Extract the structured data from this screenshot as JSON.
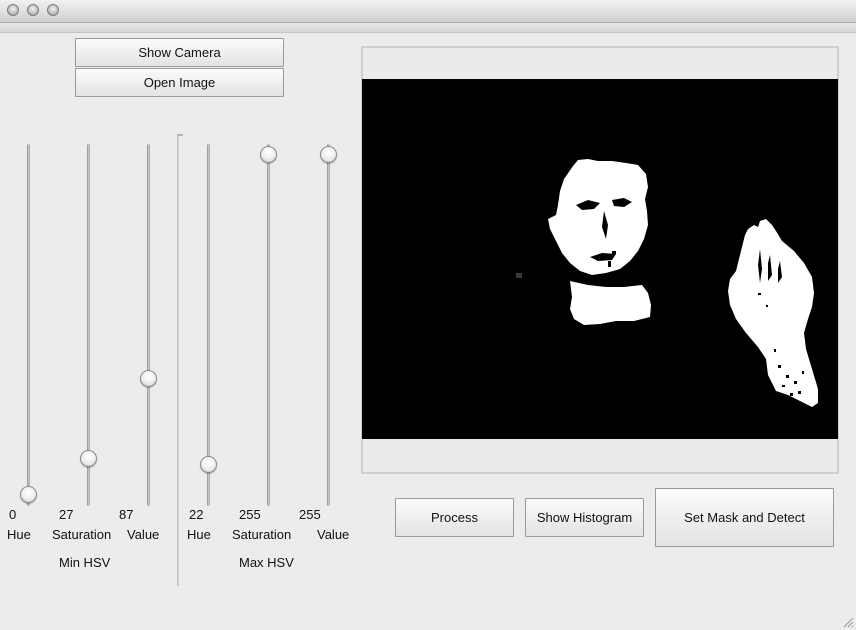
{
  "toolbar": {
    "show_camera_label": "Show Camera",
    "open_image_label": "Open Image"
  },
  "min_hsv": {
    "group_label": "Min HSV",
    "hue": {
      "label": "Hue",
      "value": "0",
      "level": 0
    },
    "saturation": {
      "label": "Saturation",
      "value": "27",
      "level": 27
    },
    "value": {
      "label": "Value",
      "value": "87",
      "level": 87
    }
  },
  "max_hsv": {
    "group_label": "Max HSV",
    "hue": {
      "label": "Hue",
      "value": "22",
      "level": 22
    },
    "saturation": {
      "label": "Saturation",
      "value": "255",
      "level": 255
    },
    "value": {
      "label": "Value",
      "value": "255",
      "level": 255
    }
  },
  "slider_range": [
    0,
    255
  ],
  "actions": {
    "process_label": "Process",
    "histogram_label": "Show Histogram",
    "mask_detect_label": "Set Mask and Detect"
  },
  "colors": {
    "window_bg": "#ececec",
    "image_bg": "#000000",
    "mask_fg": "#ffffff"
  }
}
